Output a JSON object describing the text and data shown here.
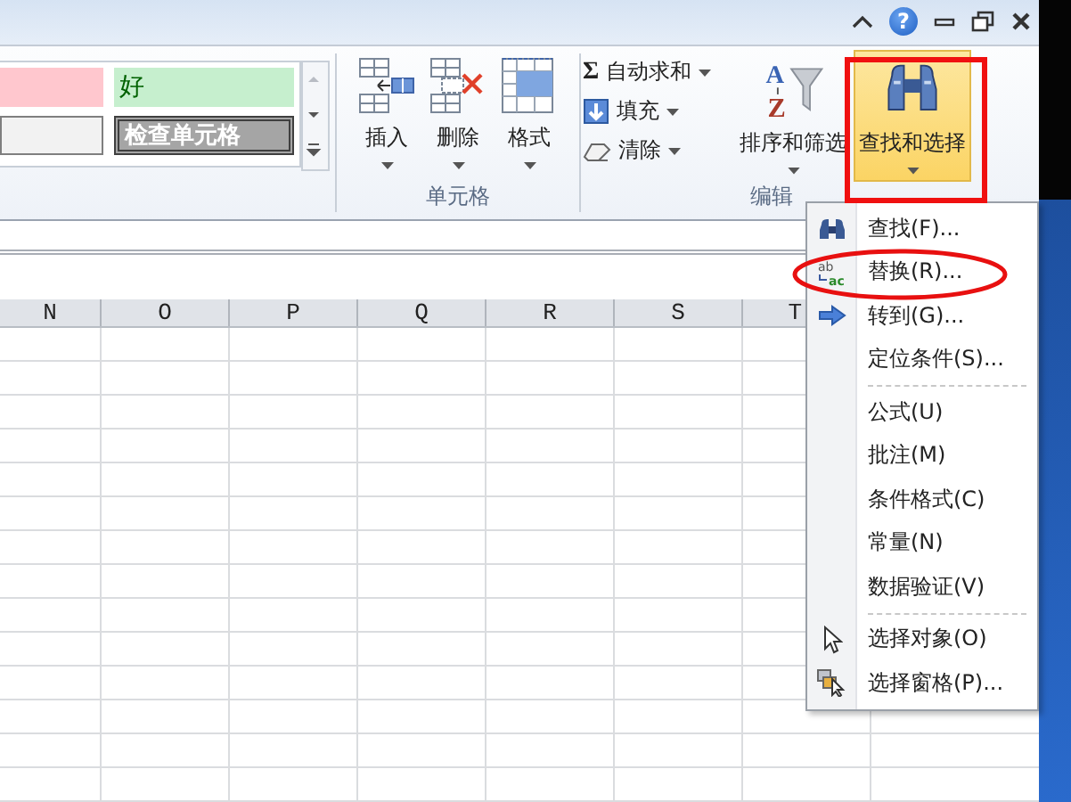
{
  "title_bar": {
    "help": "?"
  },
  "ribbon": {
    "styles_gallery": {
      "cells": [
        {
          "kind": "bad"
        },
        {
          "kind": "good",
          "label": "好"
        },
        {
          "kind": "neutral"
        },
        {
          "kind": "check",
          "label": "检查单元格"
        }
      ]
    },
    "cells_group": {
      "label": "单元格",
      "buttons": [
        {
          "kind": "insert",
          "label": "插入"
        },
        {
          "kind": "delete",
          "label": "删除"
        },
        {
          "kind": "format",
          "label": "格式"
        }
      ]
    },
    "editing_group": {
      "label": "编辑",
      "small_buttons": [
        {
          "kind": "sum",
          "icon": "Σ",
          "label": "自动求和"
        },
        {
          "kind": "fill",
          "label": "填充"
        },
        {
          "kind": "clear",
          "label": "清除"
        }
      ],
      "large_buttons": [
        {
          "kind": "sort",
          "icon_letters": [
            "A",
            "Z"
          ],
          "label": "排序和筛选",
          "selected": false
        },
        {
          "kind": "find",
          "label": "查找和选择",
          "selected": true
        }
      ]
    }
  },
  "sheet": {
    "columns": [
      "N",
      "O",
      "P",
      "Q",
      "R",
      "S",
      "T"
    ]
  },
  "menu": {
    "sections": [
      [
        {
          "kind": "find",
          "label": "查找(F)..."
        },
        {
          "kind": "replace",
          "icon_letters": [
            "ab",
            "ac"
          ],
          "label": "替换(R)..."
        },
        {
          "kind": "goto",
          "label": "转到(G)..."
        },
        {
          "kind": "none",
          "label": "定位条件(S)..."
        }
      ],
      [
        {
          "kind": "none",
          "label": "公式(U)"
        },
        {
          "kind": "none",
          "label": "批注(M)"
        },
        {
          "kind": "none",
          "label": "条件格式(C)"
        },
        {
          "kind": "none",
          "label": "常量(N)"
        },
        {
          "kind": "none",
          "label": "数据验证(V)"
        }
      ],
      [
        {
          "kind": "pointer",
          "label": "选择对象(O)"
        },
        {
          "kind": "pane",
          "label": "选择窗格(P)..."
        }
      ]
    ]
  }
}
